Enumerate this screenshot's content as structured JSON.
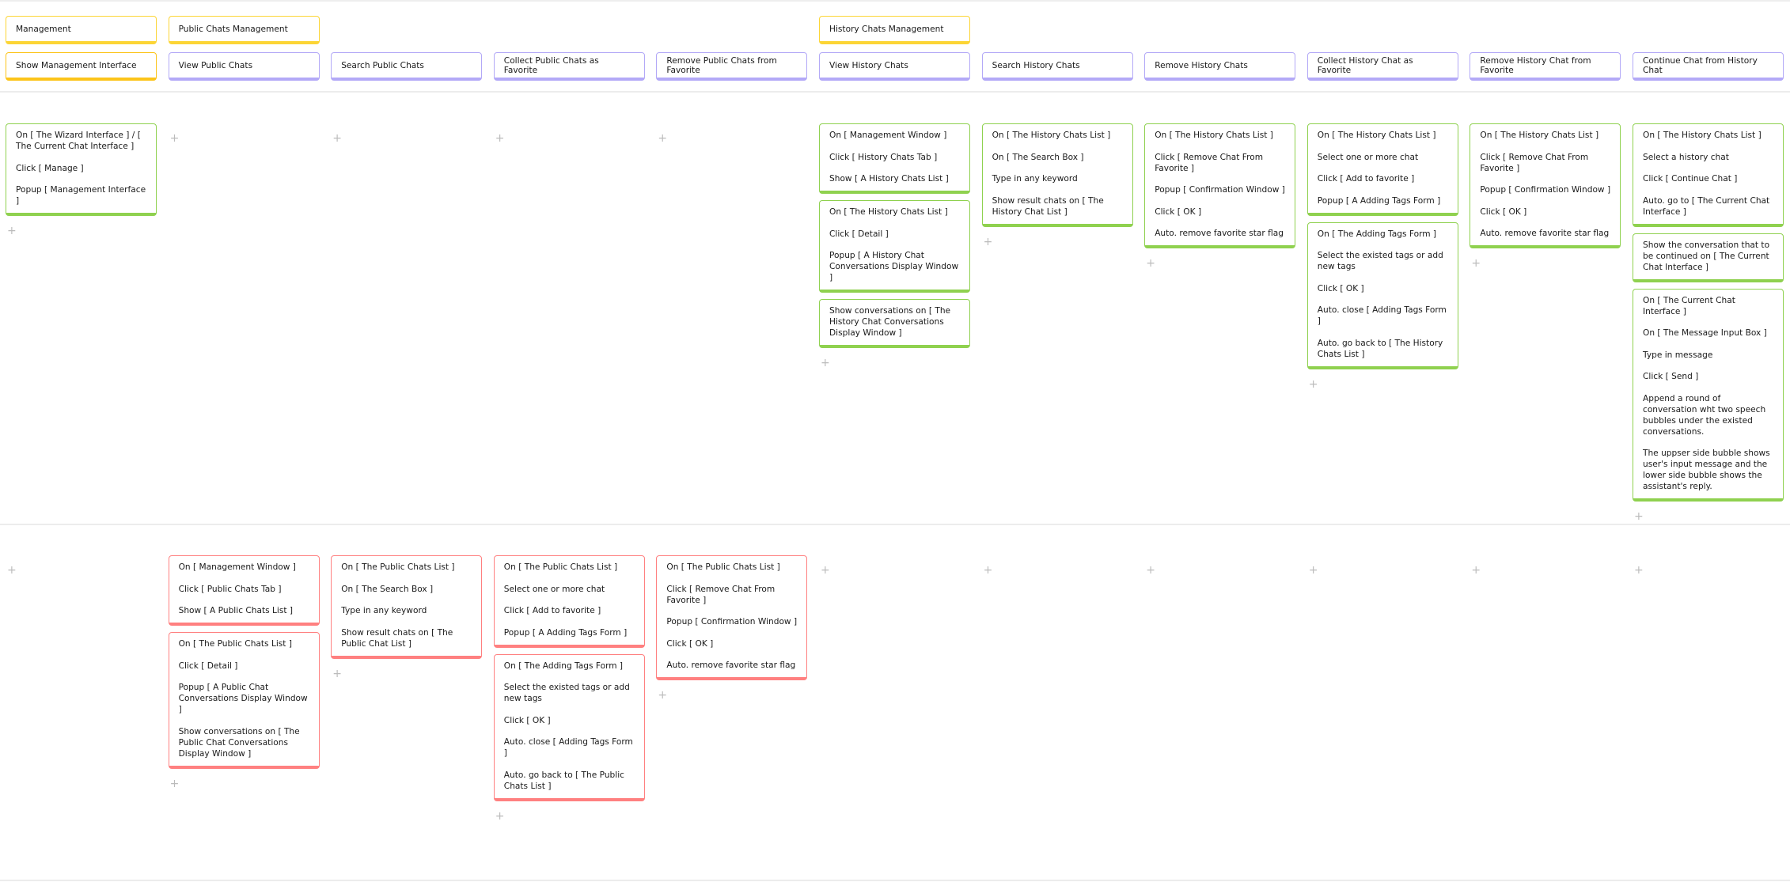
{
  "colors": {
    "group": "#fcd535",
    "feature": "#b3a9f7",
    "history_step": "#8fd14f",
    "public_step": "#ff8080",
    "management_feature": "#fcc419"
  },
  "plus_icon": "plus-icon",
  "columns": [
    {
      "group": "Management",
      "feature": "Show Management Interface",
      "feature_color": "management_feature",
      "history_cards": [
        [
          "On [ The Wizard Interface ] / [ The Current Chat Interface ]",
          "Click [ Manage ]",
          "Popup [ Management Interface ]"
        ]
      ],
      "public_cards": []
    },
    {
      "group": "Public Chats Management",
      "feature": "View Public Chats",
      "history_cards": [],
      "public_cards": [
        [
          "On [ Management Window ]",
          "Click [ Public Chats Tab ]",
          "Show [ A Public Chats List ]"
        ],
        [
          "On [ The Public Chats List ]",
          "Click [ Detail ]",
          "Popup [ A Public Chat Conversations Display Window ]",
          "Show conversations on [ The Public Chat Conversations Display Window ]"
        ]
      ]
    },
    {
      "feature": "Search Public Chats",
      "history_cards": [],
      "public_cards": [
        [
          "On [ The Public Chats List ]",
          "On [ The Search Box ]",
          "Type in any keyword",
          "Show result chats on [ The Public Chat List ]"
        ]
      ]
    },
    {
      "feature": "Collect Public Chats as Favorite",
      "history_cards": [],
      "public_cards": [
        [
          "On [ The Public Chats List ]",
          "Select one or more chat",
          "Click [ Add to favorite ]",
          "Popup [ A Adding Tags Form ]"
        ],
        [
          "On [ The Adding Tags Form ]",
          "Select the existed tags or add new tags",
          "Click [ OK ]",
          "Auto. close [ Adding Tags Form ]",
          "Auto. go back to [ The Public Chats List ]"
        ]
      ]
    },
    {
      "feature": "Remove Public Chats from Favorite",
      "history_cards": [],
      "public_cards": [
        [
          "On [ The Public Chats List ]",
          "Click [ Remove Chat From Favorite ]",
          "Popup [ Confirmation Window ]",
          "Click [ OK ]",
          "Auto. remove favorite star flag"
        ]
      ]
    },
    {
      "group": "History Chats Management",
      "feature": "View History Chats",
      "history_cards": [
        [
          "On [ Management Window ]",
          "Click [ History Chats Tab ]",
          "Show [ A History Chats List ]"
        ],
        [
          "On [ The History Chats List ]",
          "Click [ Detail ]",
          "Popup [ A History Chat Conversations Display Window ]"
        ],
        [
          "Show conversations on [ The History Chat Conversations Display Window ]"
        ]
      ],
      "public_cards": []
    },
    {
      "feature": "Search History Chats",
      "history_cards": [
        [
          "On [ The History Chats List ]",
          "On [ The Search Box ]",
          "Type in any keyword",
          "Show result chats on [ The History Chat List ]"
        ]
      ],
      "public_cards": []
    },
    {
      "feature": "Remove History Chats",
      "history_cards": [
        [
          "On [ The History Chats List ]",
          "Click [ Remove Chat From Favorite ]",
          "Popup [ Confirmation Window ]",
          "Click [ OK ]",
          "Auto. remove favorite star flag"
        ]
      ],
      "public_cards": []
    },
    {
      "feature": "Collect History Chat as Favorite",
      "history_cards": [
        [
          "On [ The History Chats List ]",
          "Select one or more chat",
          "Click [ Add to favorite ]",
          "Popup [ A Adding Tags Form ]"
        ],
        [
          "On [ The Adding Tags Form ]",
          "Select the existed tags or add new tags",
          "Click [ OK ]",
          "Auto. close [ Adding Tags Form ]",
          "Auto. go back to [ The History Chats List ]"
        ]
      ],
      "public_cards": []
    },
    {
      "feature": "Remove History Chat from Favorite",
      "history_cards": [
        [
          "On [ The History Chats List ]",
          "Click [ Remove Chat From Favorite ]",
          "Popup [ Confirmation Window ]",
          "Click [ OK ]",
          "Auto. remove favorite star flag"
        ]
      ],
      "public_cards": []
    },
    {
      "feature": "Continue Chat from History Chat",
      "history_cards": [
        [
          "On [ The History Chats List ]",
          "Select a history chat",
          "Click [ Continue Chat ]",
          "Auto. go to [ The Current Chat Interface ]"
        ],
        [
          "Show the conversation that to be continued on [ The Current Chat Interface ]"
        ],
        [
          "On [ The Current Chat Interface ]",
          "On [ The Message Input Box ]",
          "Type in message",
          "Click [ Send ]",
          "Append a round of conversation wht two speech bubbles under the existed conversations.",
          "The uppser side bubble shows user's input message and the lower side bubble shows the assistant's reply."
        ]
      ],
      "public_cards": []
    }
  ]
}
